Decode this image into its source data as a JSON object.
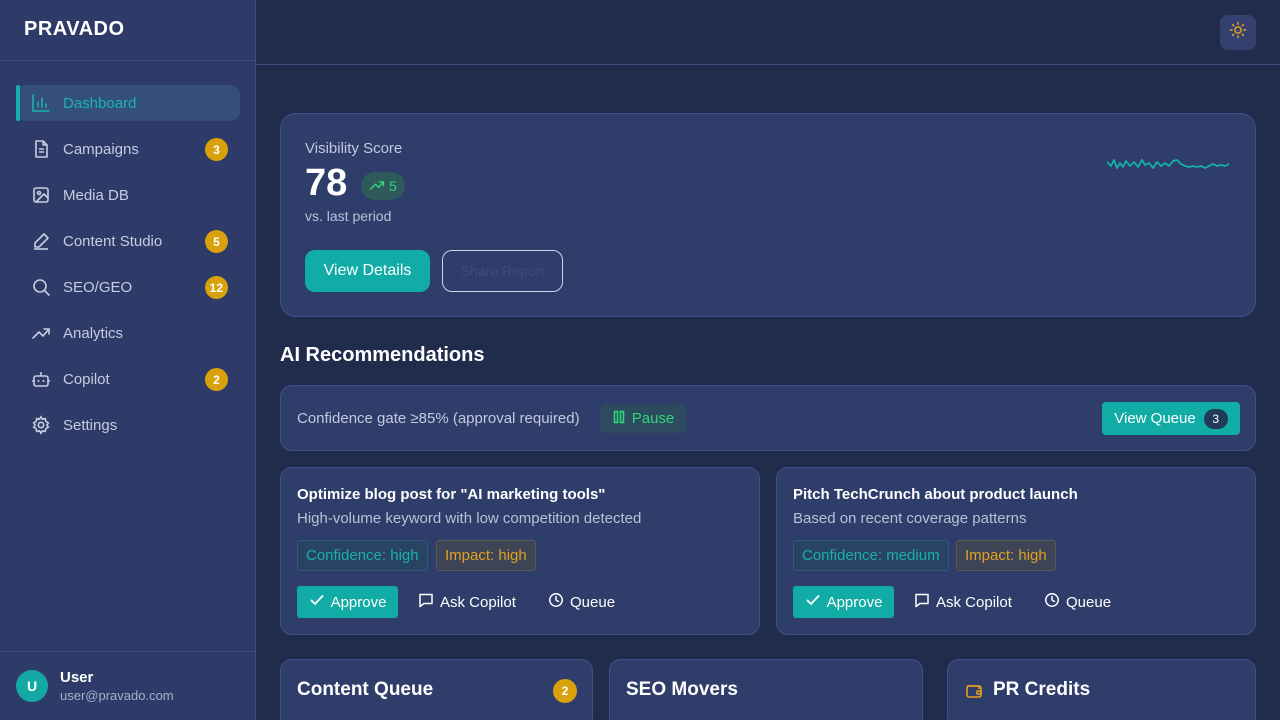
{
  "brand": "PRAVADO",
  "sidebar": {
    "items": [
      {
        "label": "Dashboard",
        "icon": "bar-chart-icon",
        "badge": null,
        "active": true
      },
      {
        "label": "Campaigns",
        "icon": "document-icon",
        "badge": "3"
      },
      {
        "label": "Media DB",
        "icon": "image-icon",
        "badge": null
      },
      {
        "label": "Content Studio",
        "icon": "pen-icon",
        "badge": "5"
      },
      {
        "label": "SEO/GEO",
        "icon": "search-icon",
        "badge": "12"
      },
      {
        "label": "Analytics",
        "icon": "trending-up-icon",
        "badge": null
      },
      {
        "label": "Copilot",
        "icon": "bot-icon",
        "badge": "2"
      },
      {
        "label": "Settings",
        "icon": "gear-icon",
        "badge": null
      }
    ]
  },
  "user": {
    "initial": "U",
    "name": "User",
    "email": "user@pravado.com"
  },
  "visibility": {
    "label": "Visibility Score",
    "score": "78",
    "delta": "5",
    "sub": "vs. last period",
    "primary_button": "View Details",
    "secondary_button": "Share Report"
  },
  "recommendations": {
    "title": "AI Recommendations",
    "gate_text": "Confidence gate ≥85% (approval required)",
    "pause_label": "Pause",
    "queue_label": "View Queue",
    "queue_count": "3",
    "cards": [
      {
        "title": "Optimize blog post for \"AI marketing tools\"",
        "desc": "High-volume keyword with low competition detected",
        "confidence": "Confidence: high",
        "impact": "Impact: high",
        "approve": "Approve",
        "ask": "Ask Copilot",
        "queue": "Queue"
      },
      {
        "title": "Pitch TechCrunch about product launch",
        "desc": "Based on recent coverage patterns",
        "confidence": "Confidence: medium",
        "impact": "Impact: high",
        "approve": "Approve",
        "ask": "Ask Copilot",
        "queue": "Queue"
      }
    ]
  },
  "bottom": {
    "content_queue": {
      "title": "Content Queue",
      "badge": "2"
    },
    "seo_movers": {
      "title": "SEO Movers"
    },
    "pr_credits": {
      "title": "PR Credits"
    }
  },
  "colors": {
    "accent": "#12aca6",
    "badge": "#d9a20c",
    "positive": "#2ed47a",
    "impact": "#e0a122"
  }
}
